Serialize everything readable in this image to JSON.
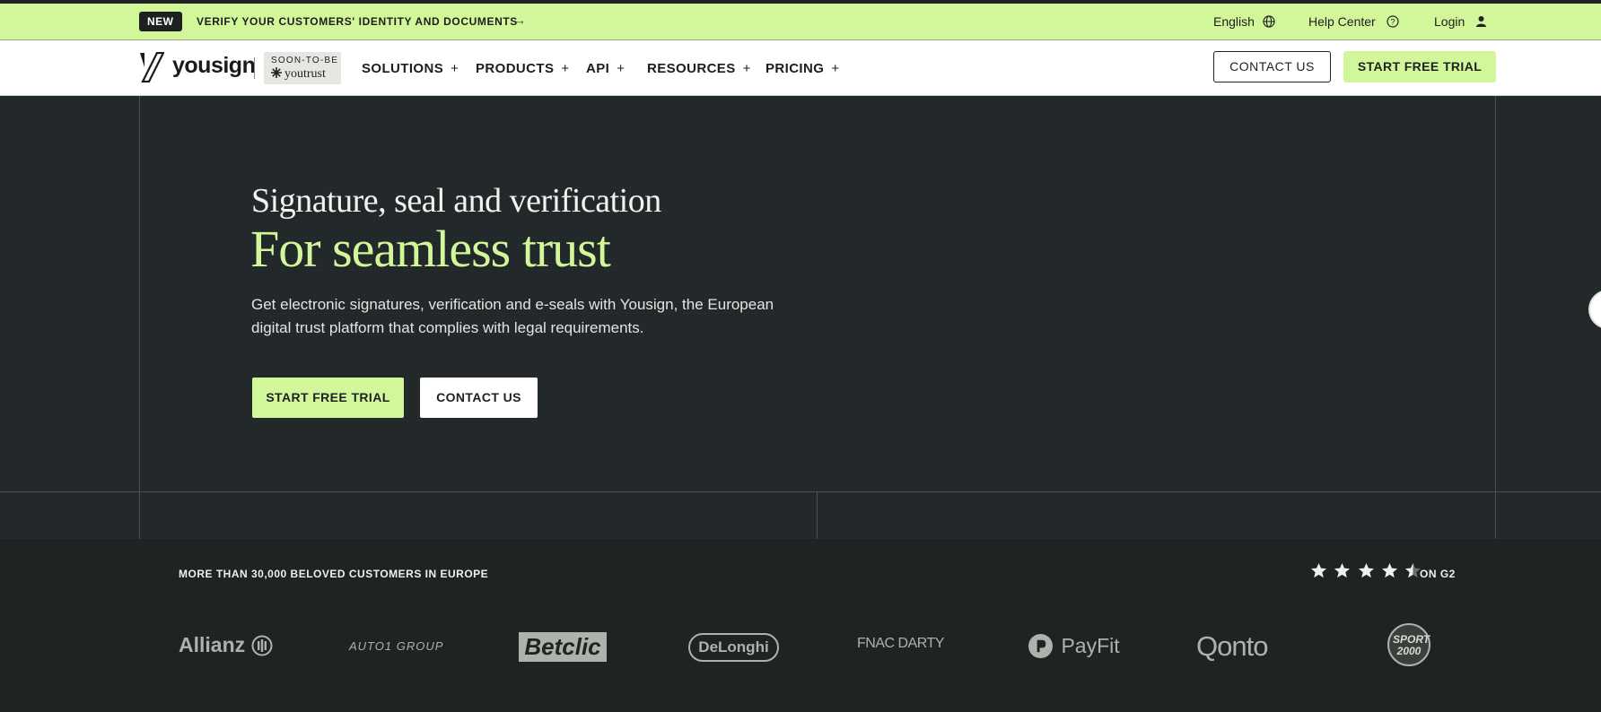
{
  "topbar": {
    "badge": "NEW",
    "promo": "VERIFY YOUR CUSTOMERS' IDENTITY AND DOCUMENTS",
    "promo_arrow": "→",
    "language": "English",
    "help": "Help Center",
    "login": "Login"
  },
  "nav": {
    "logo": "yousign",
    "soon_to_be": "SOON-TO-BE",
    "youtrust": "youtrust",
    "menu": [
      {
        "label": "SOLUTIONS",
        "plus": "+"
      },
      {
        "label": "PRODUCTS",
        "plus": "+"
      },
      {
        "label": "API",
        "plus": "+"
      },
      {
        "label": "RESOURCES",
        "plus": "+"
      },
      {
        "label": "PRICING",
        "plus": "+"
      }
    ],
    "contact": "CONTACT US",
    "trial": "START FREE TRIAL"
  },
  "hero": {
    "pretitle": "Signature, seal and verification",
    "title": "For seamless trust",
    "subtitle": "Get electronic signatures, verification and e-seals with Yousign, the European digital trust platform that complies with legal requirements.",
    "cta_primary": "START FREE TRIAL",
    "cta_secondary": "CONTACT US"
  },
  "customers": {
    "title": "MORE THAN 30,000 BELOVED CUSTOMERS IN EUROPE",
    "rating_stars": 4.5,
    "rating_label": "ON G2",
    "logos": [
      "Allianz",
      "AUTO1 GROUP",
      "Betclic",
      "DeLonghi",
      "FNAC DARTY",
      "PayFit",
      "Qonto",
      "SPORT 2000"
    ]
  },
  "colors": {
    "accent": "#d2f79a",
    "dark": "#1f2422"
  }
}
